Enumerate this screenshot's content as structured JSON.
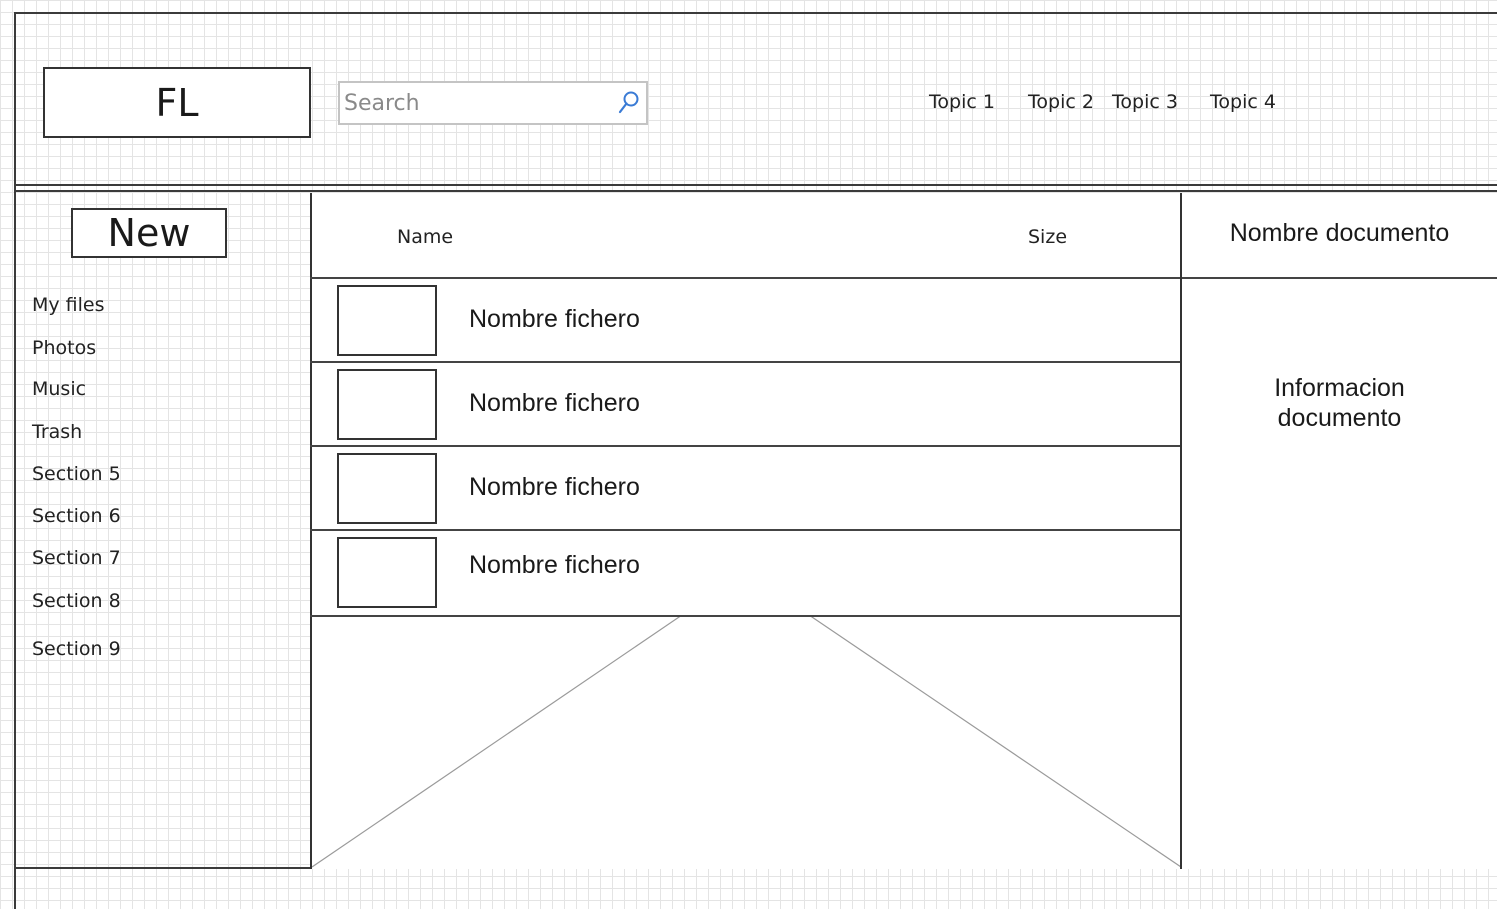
{
  "header": {
    "logo_text": "FL",
    "search": {
      "placeholder": "Search",
      "value": ""
    },
    "topics": [
      "Topic 1",
      "Topic 2",
      "Topic 3",
      "Topic 4"
    ]
  },
  "sidebar": {
    "new_label": "New",
    "items": [
      {
        "label": "My files"
      },
      {
        "label": "Photos"
      },
      {
        "label": "Music"
      },
      {
        "label": "Trash"
      },
      {
        "label": "Section 5"
      },
      {
        "label": "Section 6"
      },
      {
        "label": "Section 7"
      },
      {
        "label": "Section 8"
      },
      {
        "label": "Section 9"
      }
    ]
  },
  "file_list": {
    "columns": {
      "name": "Name",
      "size": "Size"
    },
    "rows": [
      {
        "name": "Nombre fichero"
      },
      {
        "name": "Nombre fichero"
      },
      {
        "name": "Nombre fichero"
      },
      {
        "name": "Nombre fichero"
      }
    ]
  },
  "detail": {
    "title": "Nombre documento",
    "info": "Informacion documento"
  }
}
